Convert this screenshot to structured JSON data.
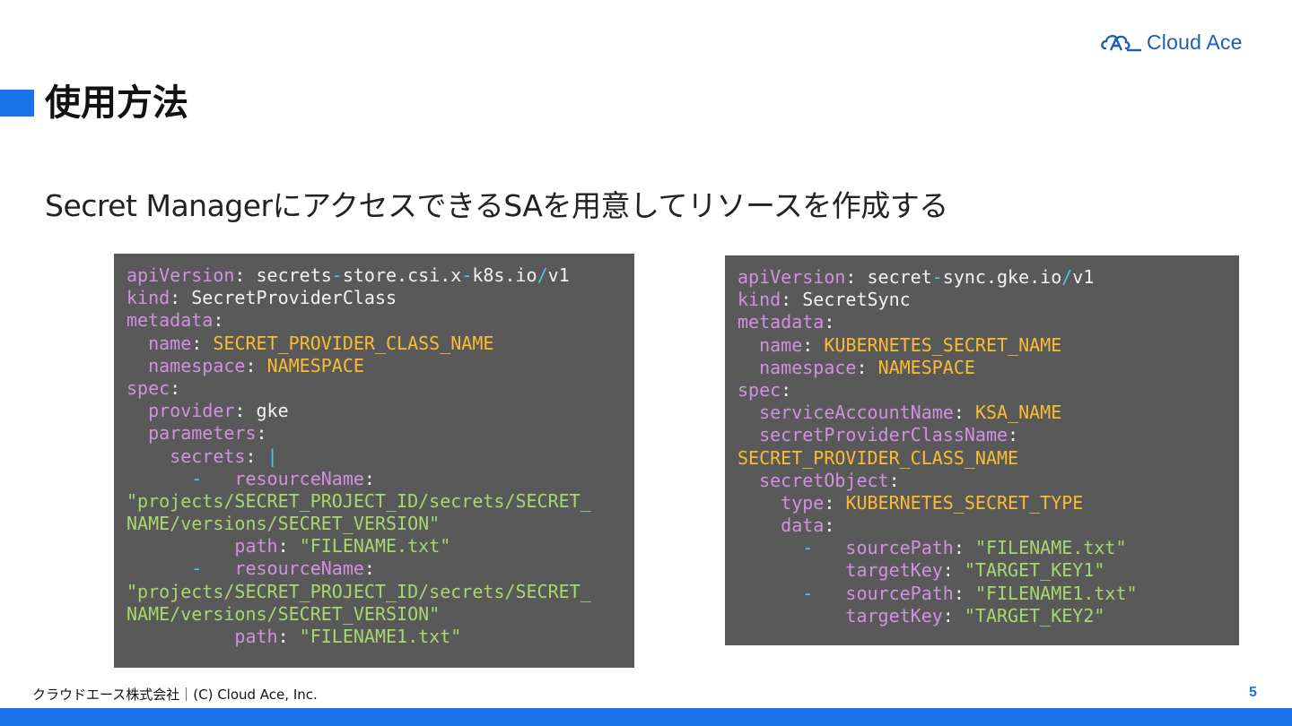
{
  "logo": {
    "text": "Cloud Ace",
    "mark_icon": "cloud-ace-logo-icon",
    "color": "#1a5fb4"
  },
  "title": "使用方法",
  "subtitle": "Secret ManagerにアクセスできるSAを用意してリソースを作成する",
  "colors": {
    "accent": "#1a73e8",
    "code_bg": "#595959",
    "key": "#d291e0",
    "value": "#fbbc32",
    "string": "#a6d86e",
    "symbol": "#52c6e6"
  },
  "left_code": [
    [
      [
        "k",
        "apiVersion"
      ],
      [
        "p",
        ": secrets"
      ],
      [
        "c",
        "-"
      ],
      [
        "p",
        "store.csi.x"
      ],
      [
        "c",
        "-"
      ],
      [
        "p",
        "k8s.io"
      ],
      [
        "c",
        "/"
      ],
      [
        "p",
        "v1"
      ]
    ],
    [
      [
        "k",
        "kind"
      ],
      [
        "p",
        ": SecretProviderClass"
      ]
    ],
    [
      [
        "k",
        "metadata"
      ],
      [
        "p",
        ":"
      ]
    ],
    [
      [
        "p",
        "  "
      ],
      [
        "k",
        "name"
      ],
      [
        "p",
        ": "
      ],
      [
        "v",
        "SECRET_PROVIDER_CLASS_NAME"
      ]
    ],
    [
      [
        "p",
        "  "
      ],
      [
        "k",
        "namespace"
      ],
      [
        "p",
        ": "
      ],
      [
        "v",
        "NAMESPACE"
      ]
    ],
    [
      [
        "k",
        "spec"
      ],
      [
        "p",
        ":"
      ]
    ],
    [
      [
        "p",
        "  "
      ],
      [
        "k",
        "provider"
      ],
      [
        "p",
        ": gke"
      ]
    ],
    [
      [
        "p",
        "  "
      ],
      [
        "k",
        "parameters"
      ],
      [
        "p",
        ":"
      ]
    ],
    [
      [
        "p",
        "    "
      ],
      [
        "k",
        "secrets"
      ],
      [
        "p",
        ": "
      ],
      [
        "c",
        "|"
      ]
    ],
    [
      [
        "p",
        "      "
      ],
      [
        "c",
        "-"
      ],
      [
        "p",
        "   "
      ],
      [
        "k",
        "resourceName"
      ],
      [
        "p",
        ":"
      ]
    ],
    [
      [
        "s",
        "\"projects/SECRET_PROJECT_ID/secrets/SECRET_"
      ]
    ],
    [
      [
        "s",
        "NAME/versions/SECRET_VERSION\""
      ]
    ],
    [
      [
        "p",
        "          "
      ],
      [
        "k",
        "path"
      ],
      [
        "p",
        ": "
      ],
      [
        "s",
        "\"FILENAME.txt\""
      ]
    ],
    [
      [
        "p",
        "      "
      ],
      [
        "c",
        "-"
      ],
      [
        "p",
        "   "
      ],
      [
        "k",
        "resourceName"
      ],
      [
        "p",
        ":"
      ]
    ],
    [
      [
        "s",
        "\"projects/SECRET_PROJECT_ID/secrets/SECRET_"
      ]
    ],
    [
      [
        "s",
        "NAME/versions/SECRET_VERSION\""
      ]
    ],
    [
      [
        "p",
        "          "
      ],
      [
        "k",
        "path"
      ],
      [
        "p",
        ": "
      ],
      [
        "s",
        "\"FILENAME1.txt\""
      ]
    ]
  ],
  "right_code": [
    [
      [
        "k",
        "apiVersion"
      ],
      [
        "p",
        ": secret"
      ],
      [
        "c",
        "-"
      ],
      [
        "p",
        "sync.gke.io"
      ],
      [
        "c",
        "/"
      ],
      [
        "p",
        "v1"
      ]
    ],
    [
      [
        "k",
        "kind"
      ],
      [
        "p",
        ": SecretSync"
      ]
    ],
    [
      [
        "k",
        "metadata"
      ],
      [
        "p",
        ":"
      ]
    ],
    [
      [
        "p",
        "  "
      ],
      [
        "k",
        "name"
      ],
      [
        "p",
        ": "
      ],
      [
        "v",
        "KUBERNETES_SECRET_NAME"
      ]
    ],
    [
      [
        "p",
        "  "
      ],
      [
        "k",
        "namespace"
      ],
      [
        "p",
        ": "
      ],
      [
        "v",
        "NAMESPACE"
      ]
    ],
    [
      [
        "k",
        "spec"
      ],
      [
        "p",
        ":"
      ]
    ],
    [
      [
        "p",
        "  "
      ],
      [
        "k",
        "serviceAccountName"
      ],
      [
        "p",
        ": "
      ],
      [
        "v",
        "KSA_NAME"
      ]
    ],
    [
      [
        "p",
        "  "
      ],
      [
        "k",
        "secretProviderClassName"
      ],
      [
        "p",
        ":"
      ]
    ],
    [
      [
        "v",
        "SECRET_PROVIDER_CLASS_NAME"
      ]
    ],
    [
      [
        "p",
        "  "
      ],
      [
        "k",
        "secretObject"
      ],
      [
        "p",
        ":"
      ]
    ],
    [
      [
        "p",
        "    "
      ],
      [
        "k",
        "type"
      ],
      [
        "p",
        ": "
      ],
      [
        "v",
        "KUBERNETES_SECRET_TYPE"
      ]
    ],
    [
      [
        "p",
        "    "
      ],
      [
        "k",
        "data"
      ],
      [
        "p",
        ":"
      ]
    ],
    [
      [
        "p",
        "      "
      ],
      [
        "c",
        "-"
      ],
      [
        "p",
        "   "
      ],
      [
        "k",
        "sourcePath"
      ],
      [
        "p",
        ": "
      ],
      [
        "s",
        "\"FILENAME.txt\""
      ]
    ],
    [
      [
        "p",
        "          "
      ],
      [
        "k",
        "targetKey"
      ],
      [
        "p",
        ": "
      ],
      [
        "s",
        "\"TARGET_KEY1\""
      ]
    ],
    [
      [
        "p",
        "      "
      ],
      [
        "c",
        "-"
      ],
      [
        "p",
        "   "
      ],
      [
        "k",
        "sourcePath"
      ],
      [
        "p",
        ": "
      ],
      [
        "s",
        "\"FILENAME1.txt\""
      ]
    ],
    [
      [
        "p",
        "          "
      ],
      [
        "k",
        "targetKey"
      ],
      [
        "p",
        ": "
      ],
      [
        "s",
        "\"TARGET_KEY2\""
      ]
    ]
  ],
  "footer": {
    "copyright": "クラウドエース株式会社｜(C) Cloud Ace, Inc.",
    "page_number": "5"
  }
}
